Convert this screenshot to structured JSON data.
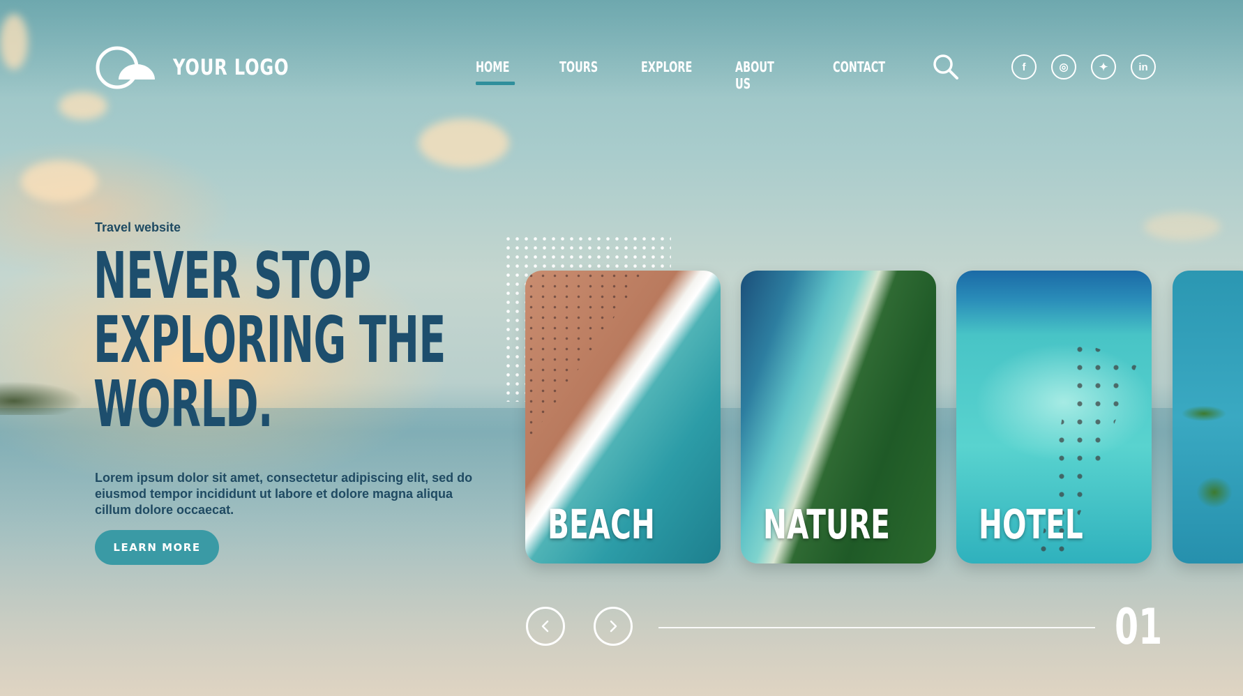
{
  "header": {
    "logo_text": "YOUR LOGO",
    "nav": [
      {
        "label": "HOME",
        "active": true
      },
      {
        "label": "TOURS",
        "active": false
      },
      {
        "label": "EXPLORE",
        "active": false
      },
      {
        "label": "ABOUT US",
        "active": false
      },
      {
        "label": "CONTACT",
        "active": false
      }
    ],
    "search_icon": "search-icon",
    "socials": [
      {
        "name": "facebook-icon",
        "glyph": "f"
      },
      {
        "name": "instagram-icon",
        "glyph": "◎"
      },
      {
        "name": "twitter-icon",
        "glyph": "✦"
      },
      {
        "name": "linkedin-icon",
        "glyph": "in"
      }
    ]
  },
  "hero": {
    "tagline": "Travel website",
    "headline_lines": [
      "NEVER STOP",
      "EXPLORING THE",
      "WORLD."
    ],
    "description": "Lorem ipsum dolor sit amet, consectetur adipiscing elit, sed do eiusmod tempor incididunt ut labore et dolore magna aliqua cillum dolore occaecat.",
    "cta_label": "LEARN MORE"
  },
  "cards": [
    {
      "label": "BEACH"
    },
    {
      "label": "NATURE"
    },
    {
      "label": "HOTEL"
    }
  ],
  "carousel": {
    "prev_icon": "chevron-left-icon",
    "next_icon": "chevron-right-icon",
    "counter": "01"
  },
  "colors": {
    "headline": "#1d4e6d",
    "accent": "#3a9aa5",
    "nav_underline": "#2f8f9c"
  }
}
